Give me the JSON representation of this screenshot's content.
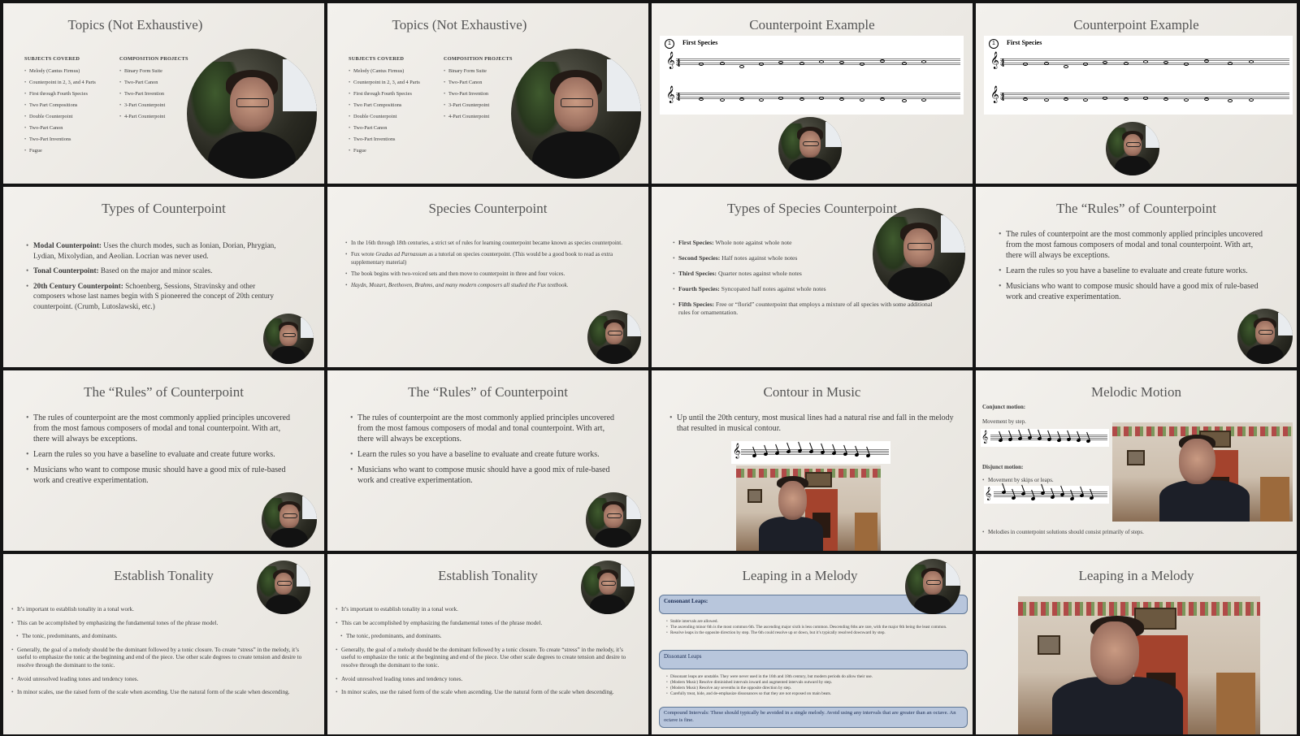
{
  "slides": {
    "s1": {
      "title": "Topics (Not Exhaustive)",
      "subjects_head": "SUBJECTS COVERED",
      "subjects": [
        "Melody (Cantus Firmus)",
        "Counterpoint in 2, 3, and 4 Parts",
        "First through Fourth Species",
        "Two Part Compositions",
        "Double Counterpoint",
        "Two-Part Canon",
        "Two-Part Inventions",
        "Fugue"
      ],
      "projects_head": "COMPOSITION PROJECTS",
      "projects": [
        "Binary Form Suite",
        "Two-Part Canon",
        "Two-Part Invention",
        "3-Part Counterpoint",
        "4-Part Counterpoint"
      ]
    },
    "s3": {
      "title": "Counterpoint Example",
      "number": "1",
      "species_label": "First Species"
    },
    "s5": {
      "title": "Types of Counterpoint",
      "items": [
        {
          "term": "Modal Counterpoint:",
          "text": " Uses the church modes, such as Ionian, Dorian, Phrygian, Lydian, Mixolydian, and Aeolian. Locrian was never used."
        },
        {
          "term": "Tonal Counterpoint:",
          "text": " Based on the major and minor scales."
        },
        {
          "term": "20th Century Counterpoint:",
          "text": " Schoenberg, Sessions, Stravinsky and other composers whose last names begin with S pioneered the concept of 20th century counterpoint. (Crumb, Lutoslawski, etc.)"
        }
      ]
    },
    "s6": {
      "title": "Species Counterpoint",
      "b1": "In the 16th through 18th centuries, a strict set of rules for learning counterpoint became known as species counterpoint.",
      "b2_pre": "Fux wrote ",
      "b2_em": "Gradus ad Parnassum",
      "b2_post": " as a tutorial on species counterpoint. (This would be a good book to read as extra supplementary material)",
      "b3": "The book begins with two-voiced sets and then move to counterpoint in three and four voices.",
      "b4": "Haydn, Mozart, Beethoven, Brahms, and many modern composers all studied the Fux textbook."
    },
    "s7": {
      "title": "Types of Species Counterpoint",
      "items": [
        {
          "term": "First Species:",
          "text": " Whole note against whole note"
        },
        {
          "term": "Second Species:",
          "text": " Half notes against whole notes"
        },
        {
          "term": "Third Species:",
          "text": " Quarter notes against whole notes"
        },
        {
          "term": "Fourth Species:",
          "text": " Syncopated half notes against whole notes"
        },
        {
          "term": "Fifth Species:",
          "text": " Free or “florid” counterpoint that employs a mixture of all species with some additional rules for ornamentation."
        }
      ]
    },
    "rules": {
      "title": "The “Rules” of Counterpoint",
      "b1": "The rules of counterpoint are the most commonly applied principles uncovered from the most famous composers of modal and tonal counterpoint. With art, there will always be exceptions.",
      "b2": "Learn the rules so you have a baseline to evaluate and create future works.",
      "b3": "Musicians who want to compose music should have a good mix of rule-based work and creative experimentation."
    },
    "s11": {
      "title": "Contour in Music",
      "b1": "Up until the 20th century, most musical lines had a natural rise and fall in the melody that resulted in musical contour."
    },
    "s12": {
      "title": "Melodic Motion",
      "conjunct_head": "Conjunct motion:",
      "conjunct_text": "Movement by step.",
      "disjunct_head": "Disjunct motion:",
      "disjunct_text": "Movement by skips or leaps.",
      "bottom": "Melodies in counterpoint solutions should consist primarily of steps."
    },
    "tonality": {
      "title": "Establish Tonality",
      "b1": "It’s important to establish tonality in a tonal work.",
      "b2": "This can be accomplished by emphasizing the fundamental tones of the phrase model.",
      "b3": "The tonic, predominants, and dominants.",
      "b4": "Generally, the goal of a melody should be the dominant followed by a tonic closure. To create “stress” in the melody, it’s useful to emphasize the tonic at the beginning and end of the piece. Use other scale degrees to create tension and desire to resolve through the dominant to the tonic.",
      "b5": "Avoid unresolved leading tones and tendency tones.",
      "b6": "In minor scales, use the raised form of the scale when ascending. Use the natural form of the scale when descending."
    },
    "s15": {
      "title": "Leaping in a Melody",
      "consonant_head": "Consonant Leaps:",
      "consonant_items": [
        "Stable intervals are allowed.",
        "The ascending minor 6th is the most common 6th. The ascending major sixth is less common. Descending 6ths are rare, with the major 6th being the least common.",
        "Resolve leaps in the opposite direction by step. The 6th could resolve up or down, but it’s typically resolved downward by step."
      ],
      "dissonant_head": "Dissonant Leaps",
      "dissonant_items": [
        "Dissonant leaps are unstable. They were never used in the 16th and 18th century, but modern periods do allow their use.",
        "(Modern Music) Resolve diminished intervals inward and augmented intervals outward by step.",
        "(Modern Music) Resolve any sevenths in the opposite direction by step.",
        "Carefully treat, hide, and de-emphasize dissonances so that they are not exposed on main beats."
      ],
      "compound": "Compound Intervals: These should typically be avoided in a single melody. Avoid using any intervals that are greater than an octave. An octave is fine."
    },
    "s16": {
      "title": "Leaping in a Melody"
    }
  },
  "colors": {
    "slide_bg": "#efece7",
    "frame_bg": "#141414",
    "leap_box": "#b8c6dc",
    "leap_box_border": "#5f7796"
  }
}
